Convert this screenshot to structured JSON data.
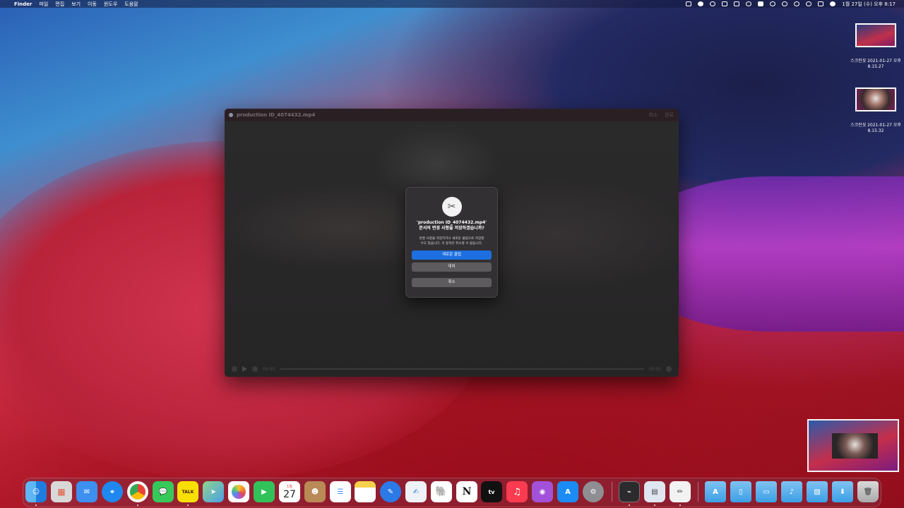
{
  "menubar": {
    "app": "Finder",
    "menus": [
      "파일",
      "편집",
      "보기",
      "이동",
      "윈도우",
      "도움말"
    ],
    "clock": "1월 27일 (수) 오후 8:17"
  },
  "desktop": {
    "icons": [
      {
        "name_line1": "스크린샷 2021-01-27 오후",
        "name_line2": "8.15.27"
      },
      {
        "name_line1": "스크린샷 2021-01-27 오후",
        "name_line2": "8.15.32"
      }
    ]
  },
  "player": {
    "title": "production ID_4074432.mp4",
    "actions": [
      "취소",
      "완료"
    ],
    "time_current": "00:00",
    "time_total": "00:00"
  },
  "dialog": {
    "icon": "scissors-icon",
    "title_line1": "'production ID_4074432.mp4'",
    "title_line2": "문서의 변경 사항을 저장하겠습니까?",
    "message_line1": "변경 사항을 저장하거나 새로운 클립으로 저장할",
    "message_line2": "수도 있습니다. 이 동작은 취소할 수 없습니다.",
    "primary_button": "새로운 클립",
    "replace_button": "대치",
    "cancel_button": "취소"
  },
  "dock": {
    "calendar_day": "27",
    "calendar_month": "1월",
    "kakao_label": "TALK",
    "tv_label": "tv",
    "notion_label": "N",
    "colors": {
      "finder": "#2e8ef0",
      "mail": "#3d8ff0",
      "facetime": "#32c25a",
      "music": "#fa3b50",
      "podcasts": "#a251d8",
      "appstore": "#1b8cf5"
    }
  }
}
